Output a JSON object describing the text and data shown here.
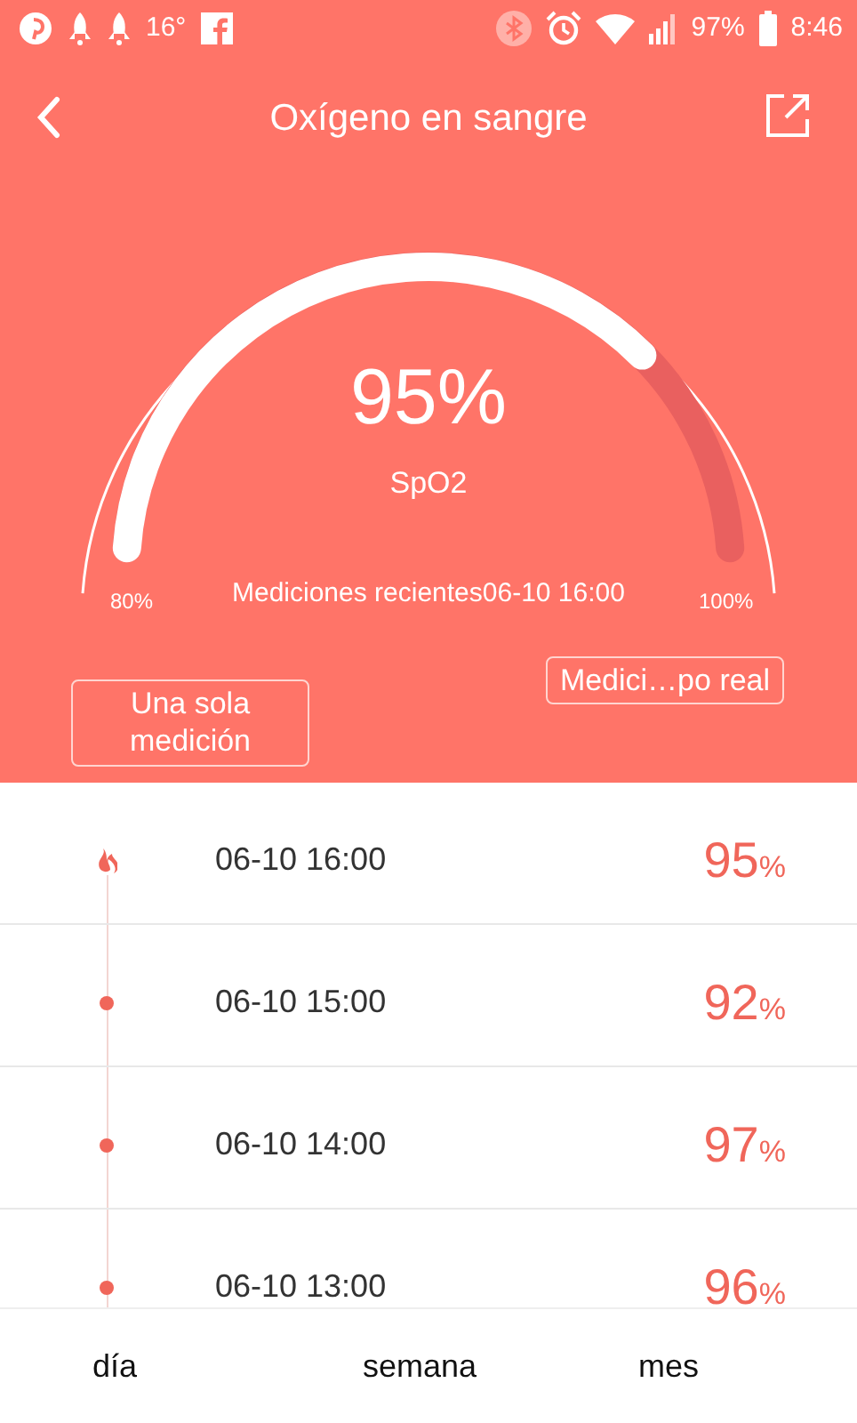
{
  "status_bar": {
    "temperature": "16°",
    "battery": "97%",
    "time": "8:46"
  },
  "header": {
    "title": "Oxígeno en sangre"
  },
  "gauge": {
    "value": "95%",
    "label": "SpO2",
    "min_label": "80%",
    "max_label": "100%",
    "recent": "Mediciones recientes06-10 16:00"
  },
  "buttons": [
    {
      "label": "Una sola medición"
    },
    {
      "label": "Medici…po real"
    }
  ],
  "readings": [
    {
      "kind": "latest",
      "time": "06-10 16:00",
      "value": "95",
      "unit": "%"
    },
    {
      "kind": "dot",
      "time": "06-10 15:00",
      "value": "92",
      "unit": "%"
    },
    {
      "kind": "dot",
      "time": "06-10 14:00",
      "value": "97",
      "unit": "%"
    },
    {
      "kind": "dot",
      "time": "06-10 13:00",
      "value": "96",
      "unit": "%"
    }
  ],
  "bottom_tabs": [
    {
      "label": "día"
    },
    {
      "label": "semana"
    },
    {
      "label": "mes"
    }
  ]
}
